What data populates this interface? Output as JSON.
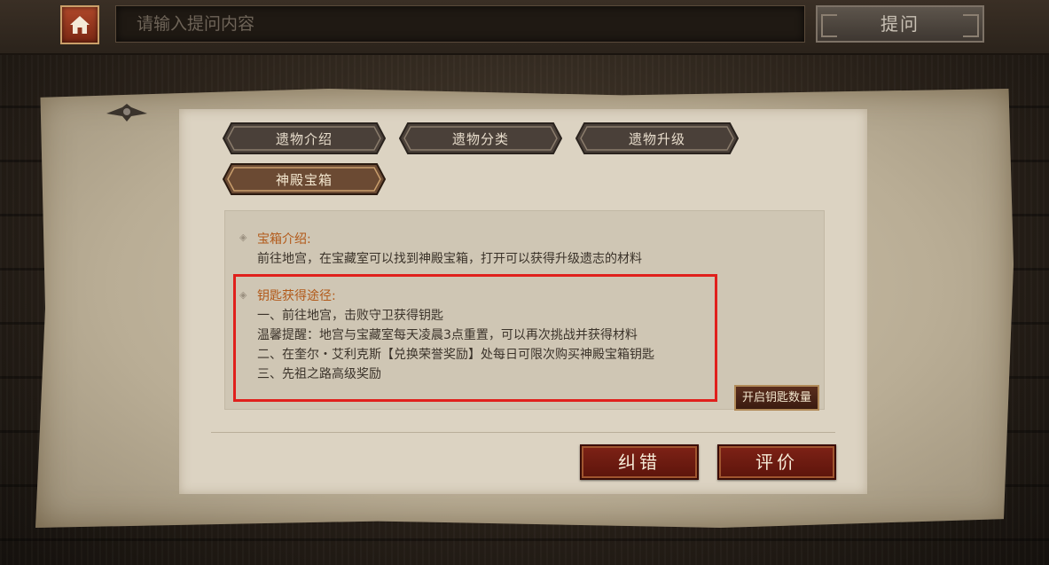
{
  "topbar": {
    "search_placeholder": "请输入提问内容",
    "ask_label": "提问"
  },
  "tabs": [
    {
      "label": "遗物介绍",
      "active": false
    },
    {
      "label": "遗物分类",
      "active": false
    },
    {
      "label": "遗物升级",
      "active": false
    },
    {
      "label": "神殿宝箱",
      "active": true
    }
  ],
  "content": {
    "section1": {
      "title": "宝箱介绍:",
      "lines": [
        "前往地宫，在宝藏室可以找到神殿宝箱，打开可以获得升级遗志的材料"
      ]
    },
    "section2": {
      "title": "钥匙获得途径:",
      "lines": [
        "一、前往地宫，击败守卫获得钥匙",
        "温馨提醒：地宫与宝藏室每天凌晨3点重置，可以再次挑战并获得材料",
        "二、在奎尔・艾利克斯【兑换荣誉奖励】处每日可限次购买神殿宝箱钥匙",
        "三、先祖之路高级奖励"
      ]
    },
    "open_count_label": "开启钥匙数量"
  },
  "actions": {
    "correct_label": "纠错",
    "rate_label": "评价"
  },
  "colors": {
    "accent_title": "#b25a1a",
    "highlight_box": "#e0201c",
    "button_red": "#7e2216"
  }
}
